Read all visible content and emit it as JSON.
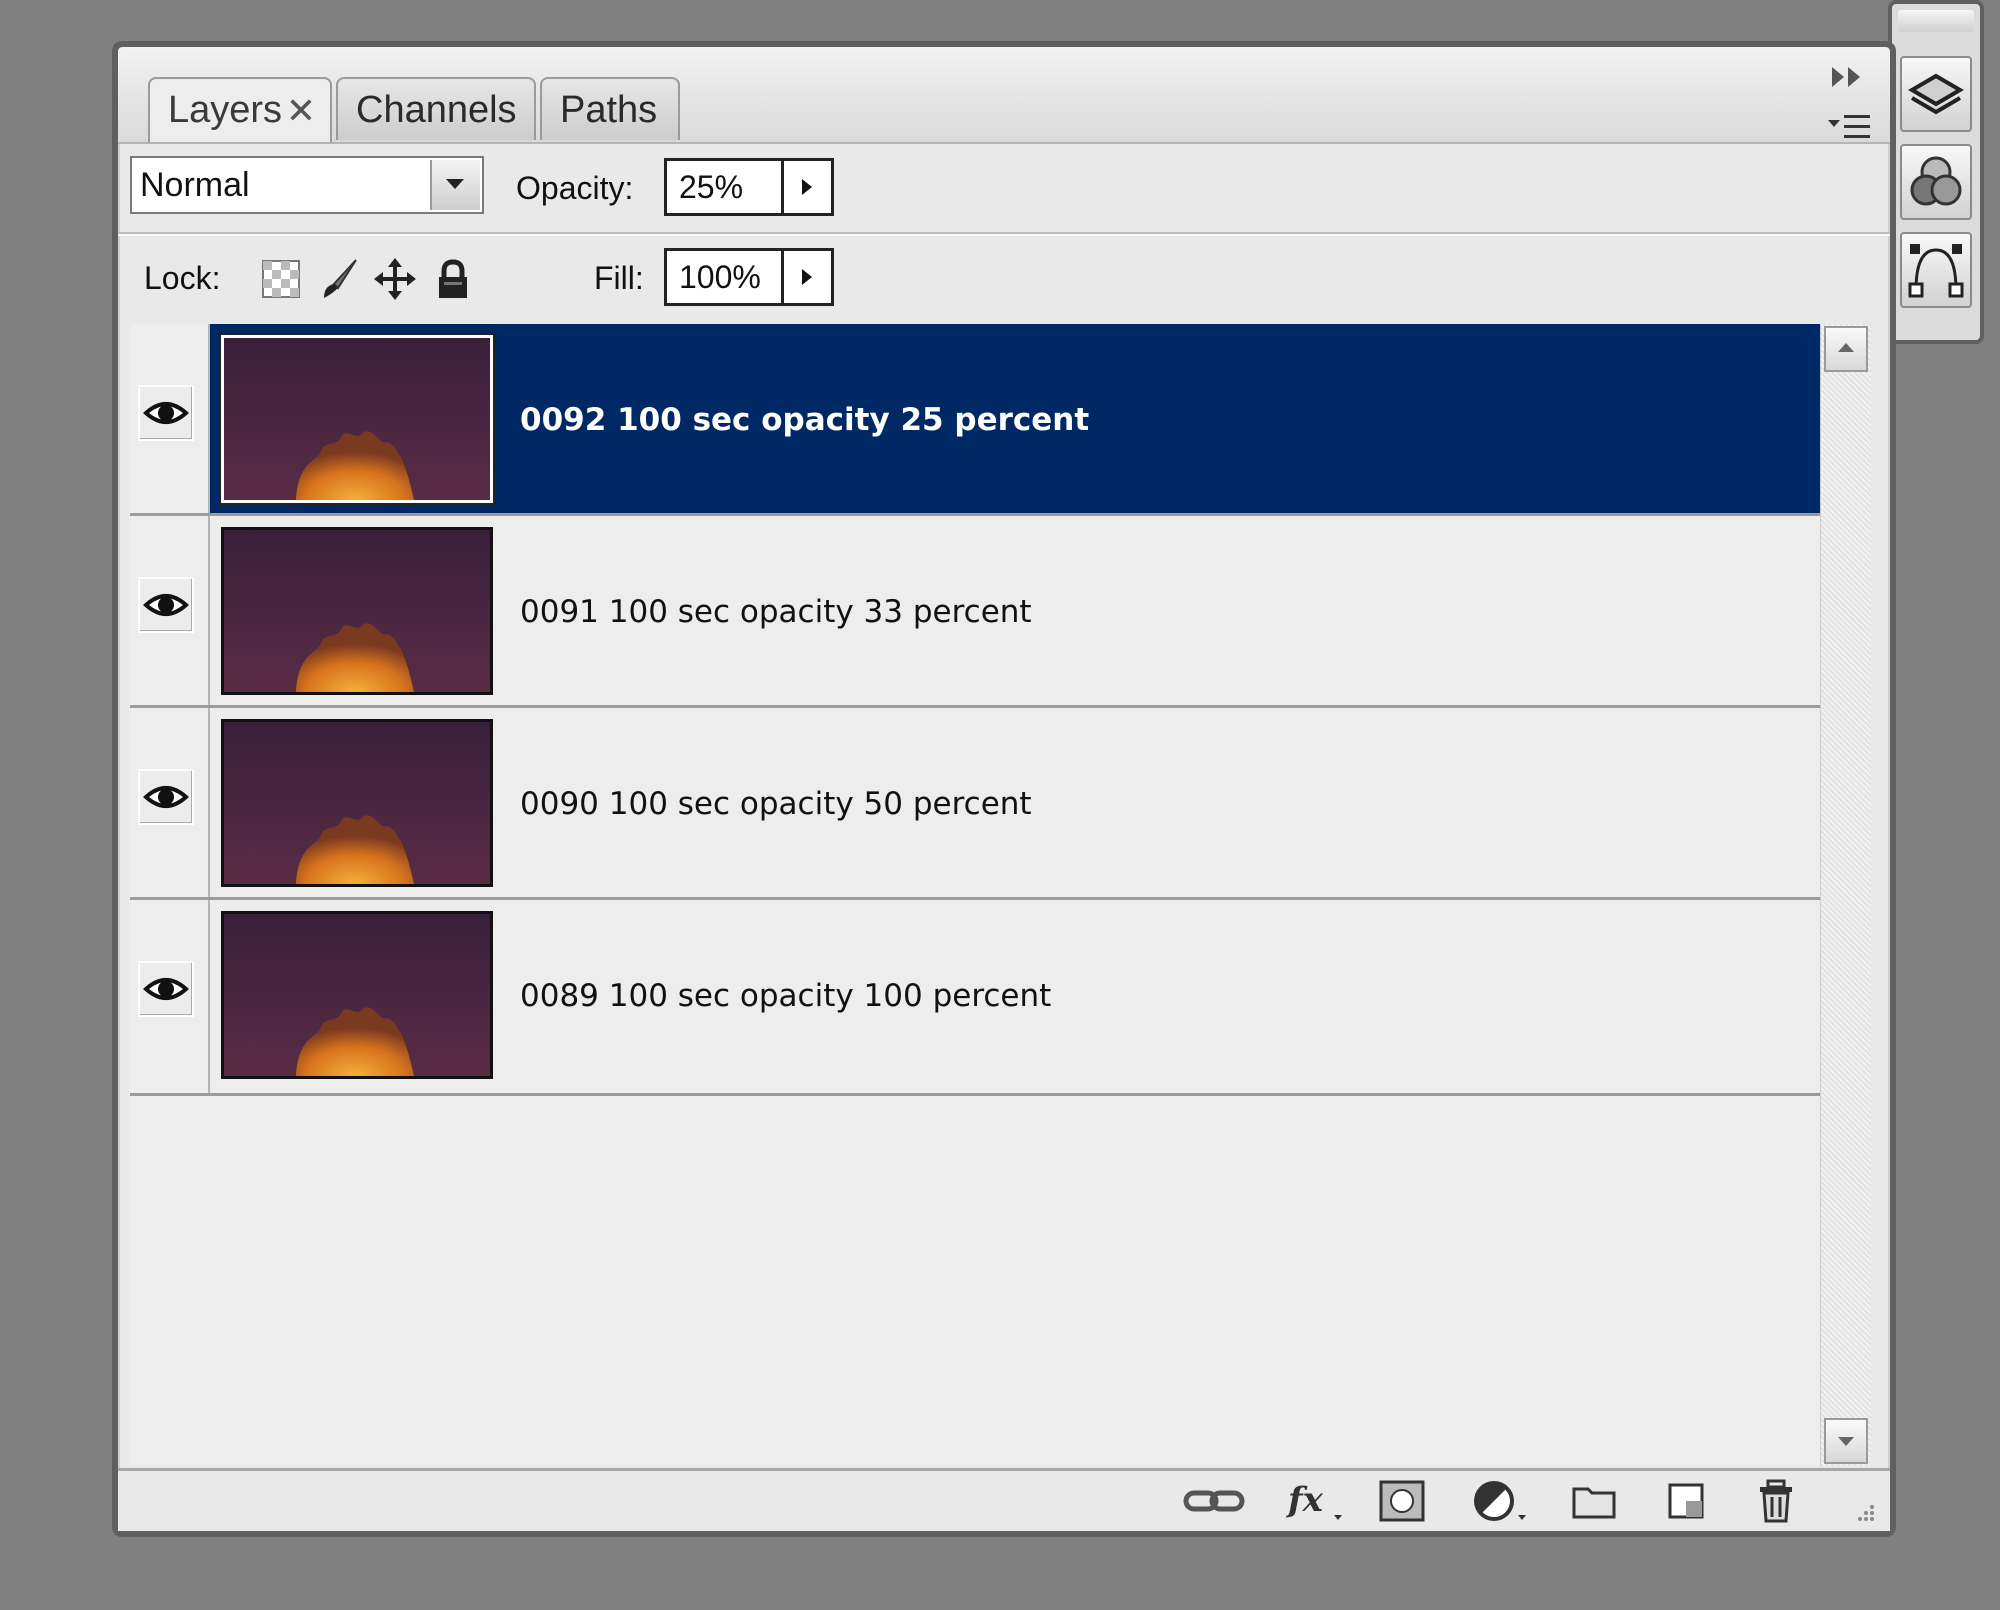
{
  "tabs": [
    {
      "label": "Layers",
      "active": true
    },
    {
      "label": "Channels",
      "active": false
    },
    {
      "label": "Paths",
      "active": false
    }
  ],
  "blend_mode": "Normal",
  "opacity": {
    "label": "Opacity:",
    "value": "25%"
  },
  "lock_label": "Lock:",
  "fill": {
    "label": "Fill:",
    "value": "100%"
  },
  "layers": [
    {
      "name": "0092 100 sec opacity 25 percent",
      "selected": true,
      "visible": true
    },
    {
      "name": "0091 100 sec opacity 33 percent",
      "selected": false,
      "visible": true
    },
    {
      "name": "0090 100 sec opacity 50 percent",
      "selected": false,
      "visible": true
    },
    {
      "name": "0089 100 sec opacity 100 percent",
      "selected": false,
      "visible": true
    }
  ],
  "colors": {
    "selection": "#002864",
    "panel_bg": "#ededed",
    "workspace": "#808080"
  }
}
